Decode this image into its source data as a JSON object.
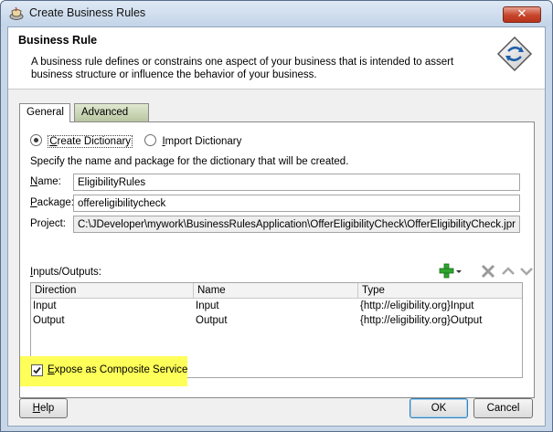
{
  "window": {
    "title": "Create Business Rules",
    "close_glyph": "✕"
  },
  "header": {
    "title": "Business Rule",
    "description": "A business rule defines or constrains one aspect of your business that is intended to assert business structure or influence the behavior of your business.",
    "icon": "business-rule-icon"
  },
  "tabs": [
    {
      "label": "General",
      "active": true
    },
    {
      "label": "Advanced",
      "active": false
    }
  ],
  "general": {
    "radio_create": {
      "mnemonic": "C",
      "rest": "reate Dictionary",
      "selected": true
    },
    "radio_import": {
      "mnemonic": "I",
      "rest": "mport Dictionary",
      "selected": false
    },
    "instruction": "Specify the name and package for the dictionary that will be created.",
    "name": {
      "mnemonic": "N",
      "rest": "ame:",
      "value": "EligibilityRules"
    },
    "package": {
      "mnemonic": "P",
      "rest": "ackage:",
      "value": "offereligibilitycheck"
    },
    "project": {
      "mnemonic": "",
      "rest": "Project:",
      "value": "C:\\JDeveloper\\mywork\\BusinessRulesApplication\\OfferEligibilityCheck\\OfferEligibilityCheck.jpr"
    },
    "io_label": {
      "mnemonic": "I",
      "rest": "nputs/Outputs:"
    },
    "table": {
      "columns": [
        "Direction",
        "Name",
        "Type"
      ],
      "rows": [
        [
          "Input",
          "Input",
          "{http://eligibility.org}Input"
        ],
        [
          "Output",
          "Output",
          "{http://eligibility.org}Output"
        ]
      ]
    },
    "expose": {
      "mnemonic": "E",
      "rest": "xpose as Composite Service",
      "checked": true
    }
  },
  "buttons": {
    "help": {
      "mnemonic": "H",
      "rest": "elp"
    },
    "ok": "OK",
    "cancel": "Cancel"
  },
  "colors": {
    "highlight": "#ffff5a",
    "add_green": "#2fa52f",
    "close_red": "#c7452b"
  }
}
